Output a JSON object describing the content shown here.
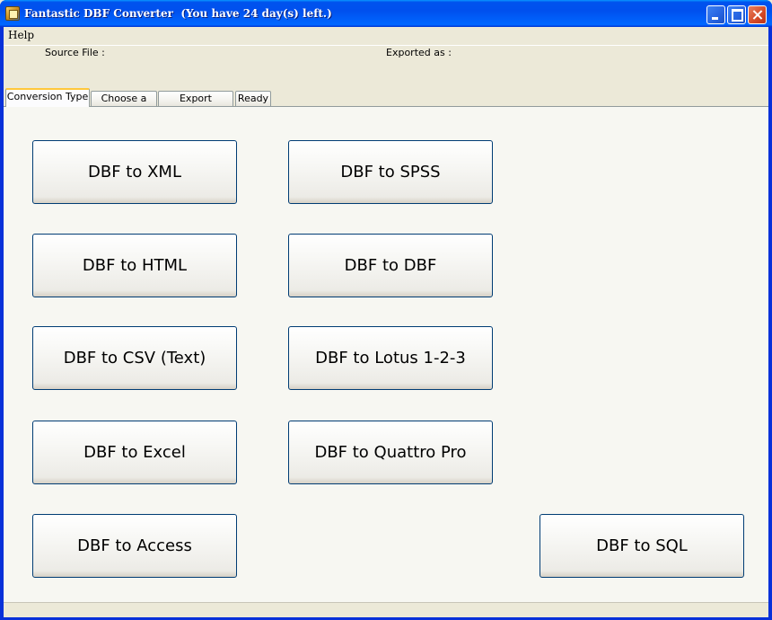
{
  "window": {
    "title": "Fantastic DBF Converter  (You have 24 day(s) left.)"
  },
  "menu": {
    "help_label": "Help"
  },
  "info": {
    "source_label": "Source File :",
    "exported_label": "Exported as :"
  },
  "tabs": [
    {
      "label": "Conversion Type",
      "active": true
    },
    {
      "label": "Choose a File",
      "active": false
    },
    {
      "label": "Export Settings",
      "active": false
    },
    {
      "label": "Ready",
      "active": false
    }
  ],
  "buttons": {
    "xml": "DBF to XML",
    "spss": "DBF to SPSS",
    "html": "DBF to HTML",
    "dbf": "DBF to DBF",
    "csv": "DBF to CSV (Text)",
    "lotus": "DBF to Lotus 1-2-3",
    "excel": "DBF to Excel",
    "quattro": "DBF to Quattro Pro",
    "access": "DBF to Access",
    "sql": "DBF to SQL"
  }
}
